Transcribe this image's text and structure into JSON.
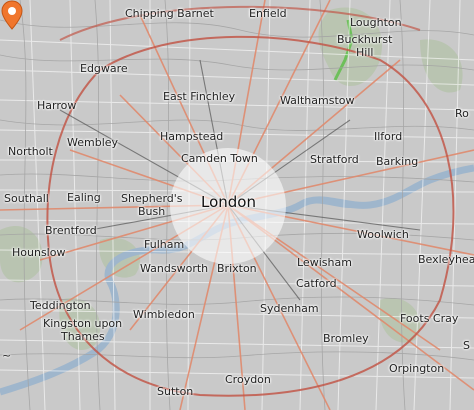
{
  "map": {
    "colors": {
      "radius_fill": "rgba(255,255,255,0.58)",
      "marker": "#f0762d",
      "water": "#9fb6cc",
      "motorway": "#e0705a"
    },
    "icons": {
      "marker": "map-pin-icon",
      "airport": "airplane-icon"
    },
    "place_labels": {
      "chipping_barnet": "Chipping Barnet",
      "enfield": "Enfield",
      "loughton": "Loughton",
      "buckhurst_hill_1": "Buckhurst",
      "buckhurst_hill_2": "Hill",
      "edgware": "Edgware",
      "east_finchley": "East Finchley",
      "walthamstow": "Walthamstow",
      "harrow": "Harrow",
      "romford_partial": "Ro",
      "wembley": "Wembley",
      "hampstead": "Hampstead",
      "ilford": "Ilford",
      "northolt": "Northolt",
      "camden_town": "Camden Town",
      "stratford": "Stratford",
      "barking": "Barking",
      "southall": "Southall",
      "ealing": "Ealing",
      "shepherds_bush_1": "Shepherd's",
      "shepherds_bush_2": "Bush",
      "london": "London",
      "woolwich": "Woolwich",
      "brentford": "Brentford",
      "fulham": "Fulham",
      "hounslow": "Hounslow",
      "wandsworth": "Wandsworth",
      "brixton": "Brixton",
      "lewisham": "Lewisham",
      "bexleyheath": "Bexleyhea",
      "catford": "Catford",
      "teddington": "Teddington",
      "wimbledon": "Wimbledon",
      "sydenham": "Sydenham",
      "kingston_1": "Kingston upon",
      "kingston_2": "Thames",
      "foots_cray": "Foots Cray",
      "bromley": "Bromley",
      "orpington": "Orpington",
      "croydon": "Croydon",
      "sutton": "Sutton",
      "edge_left": "~",
      "edge_right": "S"
    }
  }
}
